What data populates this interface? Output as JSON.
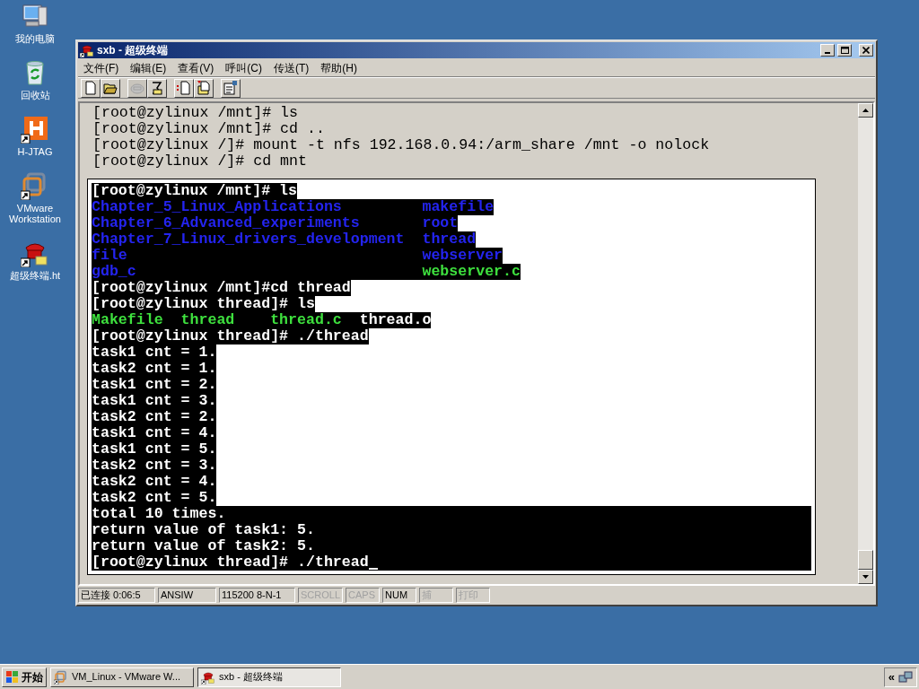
{
  "desktop_icons": [
    {
      "label": "我的电脑",
      "kind": "computer"
    },
    {
      "label": "回收站",
      "kind": "recycle"
    },
    {
      "label": "H-JTAG",
      "kind": "hjtag"
    },
    {
      "label": "VMware Workstation",
      "kind": "vmware"
    },
    {
      "label": "超级终端.ht",
      "kind": "phone"
    }
  ],
  "window": {
    "title": "sxb - 超级终端"
  },
  "menu": [
    "文件(F)",
    "编辑(E)",
    "查看(V)",
    "呼叫(C)",
    "传送(T)",
    "帮助(H)"
  ],
  "toolbar": [
    {
      "kind": "new",
      "disabled": false
    },
    {
      "kind": "open",
      "disabled": false
    },
    {
      "kind": "call",
      "disabled": true
    },
    {
      "kind": "dial",
      "disabled": false
    },
    {
      "kind": "send",
      "disabled": false
    },
    {
      "kind": "receive",
      "disabled": false
    },
    {
      "kind": "properties",
      "disabled": false
    }
  ],
  "terminal": {
    "lines": [
      "[root@zylinux /mnt]# ls",
      "[root@zylinux /mnt]# cd ..",
      "[root@zylinux /]# mount -t nfs 192.168.0.94:/arm_share /mnt -o nolock",
      "[root@zylinux /]# cd mnt"
    ],
    "panel_lines": [
      {
        "kind": "text",
        "full_width": false,
        "cursor": false,
        "segments": [
          {
            "text": "[root@zylinux /mnt]# ls",
            "kind": "plain"
          }
        ]
      },
      {
        "kind": "columns",
        "full_width": false,
        "cursor": false,
        "segments": [
          {
            "text": "Chapter_5_Linux_Applications",
            "kind": "directory"
          },
          {
            "text": "makefile",
            "kind": "directory"
          }
        ]
      },
      {
        "kind": "columns",
        "full_width": false,
        "cursor": false,
        "segments": [
          {
            "text": "Chapter_6_Advanced_experiments",
            "kind": "directory"
          },
          {
            "text": "root",
            "kind": "directory"
          }
        ]
      },
      {
        "kind": "columns",
        "full_width": false,
        "cursor": false,
        "segments": [
          {
            "text": "Chapter_7_Linux_drivers_development",
            "kind": "directory"
          },
          {
            "text": "thread",
            "kind": "directory"
          }
        ]
      },
      {
        "kind": "columns",
        "full_width": false,
        "cursor": false,
        "segments": [
          {
            "text": "file",
            "kind": "directory"
          },
          {
            "text": "webserver",
            "kind": "directory"
          }
        ]
      },
      {
        "kind": "columns",
        "full_width": false,
        "cursor": false,
        "segments": [
          {
            "text": "gdb_c",
            "kind": "directory"
          },
          {
            "text": "webserver.c",
            "kind": "executable"
          }
        ]
      },
      {
        "kind": "text",
        "full_width": false,
        "cursor": false,
        "segments": [
          {
            "text": "[root@zylinux /mnt]#cd thread",
            "kind": "plain"
          }
        ]
      },
      {
        "kind": "text",
        "full_width": false,
        "cursor": false,
        "segments": [
          {
            "text": "[root@zylinux thread]# ls",
            "kind": "plain"
          }
        ]
      },
      {
        "kind": "grid",
        "full_width": false,
        "cursor": false,
        "segments": [
          {
            "text": "Makefile",
            "kind": "executable"
          },
          {
            "text": "thread",
            "kind": "executable"
          },
          {
            "text": "thread.c",
            "kind": "executable"
          },
          {
            "text": "thread.o",
            "kind": "plain"
          }
        ]
      },
      {
        "kind": "text",
        "full_width": false,
        "cursor": false,
        "segments": [
          {
            "text": "[root@zylinux thread]# ./thread",
            "kind": "plain"
          }
        ]
      },
      {
        "kind": "text",
        "full_width": false,
        "cursor": false,
        "segments": [
          {
            "text": "task1 cnt = 1.",
            "kind": "plain"
          }
        ]
      },
      {
        "kind": "text",
        "full_width": false,
        "cursor": false,
        "segments": [
          {
            "text": "task2 cnt = 1.",
            "kind": "plain"
          }
        ]
      },
      {
        "kind": "text",
        "full_width": false,
        "cursor": false,
        "segments": [
          {
            "text": "task1 cnt = 2.",
            "kind": "plain"
          }
        ]
      },
      {
        "kind": "text",
        "full_width": false,
        "cursor": false,
        "segments": [
          {
            "text": "task1 cnt = 3.",
            "kind": "plain"
          }
        ]
      },
      {
        "kind": "text",
        "full_width": false,
        "cursor": false,
        "segments": [
          {
            "text": "task2 cnt = 2.",
            "kind": "plain"
          }
        ]
      },
      {
        "kind": "text",
        "full_width": false,
        "cursor": false,
        "segments": [
          {
            "text": "task1 cnt = 4.",
            "kind": "plain"
          }
        ]
      },
      {
        "kind": "text",
        "full_width": false,
        "cursor": false,
        "segments": [
          {
            "text": "task1 cnt = 5.",
            "kind": "plain"
          }
        ]
      },
      {
        "kind": "text",
        "full_width": false,
        "cursor": false,
        "segments": [
          {
            "text": "task2 cnt = 3.",
            "kind": "plain"
          }
        ]
      },
      {
        "kind": "text",
        "full_width": false,
        "cursor": false,
        "segments": [
          {
            "text": "task2 cnt = 4.",
            "kind": "plain"
          }
        ]
      },
      {
        "kind": "text",
        "full_width": false,
        "cursor": false,
        "segments": [
          {
            "text": "task2 cnt = 5.",
            "kind": "plain"
          }
        ]
      },
      {
        "kind": "text",
        "full_width": true,
        "cursor": false,
        "segments": [
          {
            "text": "total 10 times.",
            "kind": "plain"
          }
        ]
      },
      {
        "kind": "text",
        "full_width": true,
        "cursor": false,
        "segments": [
          {
            "text": "return value of task1: 5.",
            "kind": "plain"
          }
        ]
      },
      {
        "kind": "text",
        "full_width": true,
        "cursor": false,
        "segments": [
          {
            "text": "return value of task2: 5.",
            "kind": "plain"
          }
        ]
      },
      {
        "kind": "text",
        "full_width": true,
        "cursor": true,
        "segments": [
          {
            "text": "[root@zylinux thread]# ./thread",
            "kind": "plain"
          }
        ]
      }
    ]
  },
  "status_bar": [
    {
      "text": "已连接 0:06:5",
      "active": true
    },
    {
      "text": "ANSIW",
      "active": true
    },
    {
      "text": "115200 8-N-1",
      "active": true
    },
    {
      "text": "SCROLL",
      "active": false
    },
    {
      "text": "CAPS",
      "active": false
    },
    {
      "text": "NUM",
      "active": true
    },
    {
      "text": "捕",
      "active": false
    },
    {
      "text": "打印",
      "active": false
    }
  ],
  "taskbar": {
    "start": "开始",
    "tasks": [
      {
        "label": "VM_Linux - VMware W...",
        "kind": "vmware",
        "selected": false
      },
      {
        "label": "sxb - 超级终端",
        "kind": "phone",
        "selected": true
      }
    ],
    "tray_toggle": "«"
  }
}
